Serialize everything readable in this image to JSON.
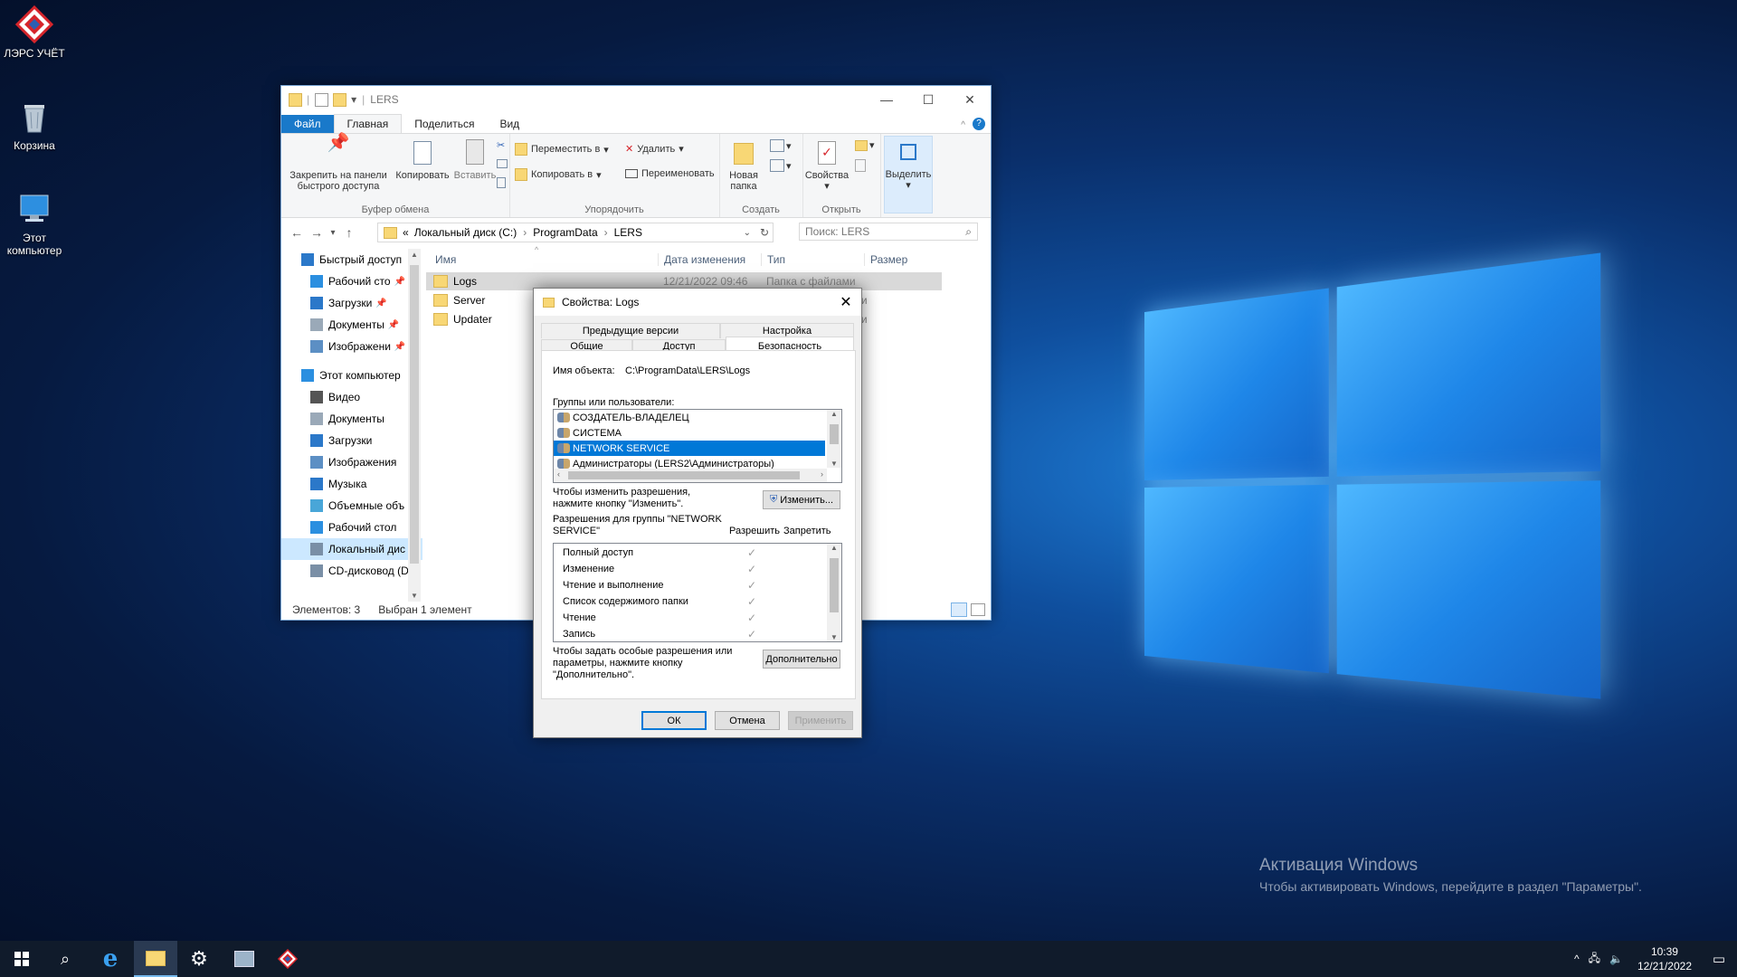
{
  "desktop": {
    "icons": [
      {
        "label": "ЛЭРС УЧЁТ"
      },
      {
        "label": "Корзина"
      },
      {
        "label": "Этот компьютер"
      }
    ],
    "watermark": {
      "title": "Активация Windows",
      "text": "Чтобы активировать Windows, перейдите в раздел \"Параметры\"."
    }
  },
  "explorer": {
    "title": "LERS",
    "tabs": {
      "file": "Файл",
      "home": "Главная",
      "share": "Поделиться",
      "view": "Вид"
    },
    "ribbon": {
      "pin": "Закрепить на панели быстрого доступа",
      "copy": "Копировать",
      "paste": "Вставить",
      "clipboard_group": "Буфер обмена",
      "move_to": "Переместить в",
      "copy_to": "Копировать в",
      "delete": "Удалить",
      "rename": "Переименовать",
      "organize_group": "Упорядочить",
      "new_folder": "Новая папка",
      "create_group": "Создать",
      "properties": "Свойства",
      "open_group": "Открыть",
      "select": "Выделить"
    },
    "address": {
      "prefix": "«",
      "crumbs": [
        "Локальный диск (C:)",
        "ProgramData",
        "LERS"
      ]
    },
    "search_placeholder": "Поиск: LERS",
    "nav": [
      {
        "label": "Быстрый доступ",
        "icon": "star-icon",
        "indent": 0
      },
      {
        "label": "Рабочий сто",
        "icon": "desktop-icon",
        "indent": 1,
        "pin": true
      },
      {
        "label": "Загрузки",
        "icon": "download-icon",
        "indent": 1,
        "pin": true
      },
      {
        "label": "Документы",
        "icon": "document-icon",
        "indent": 1,
        "pin": true
      },
      {
        "label": "Изображени",
        "icon": "image-icon",
        "indent": 1,
        "pin": true
      },
      {
        "label": "Этот компьютер",
        "icon": "computer-icon",
        "indent": 0,
        "gap": true
      },
      {
        "label": "Видео",
        "icon": "video-icon",
        "indent": 1
      },
      {
        "label": "Документы",
        "icon": "document-icon",
        "indent": 1
      },
      {
        "label": "Загрузки",
        "icon": "download-icon",
        "indent": 1
      },
      {
        "label": "Изображения",
        "icon": "image-icon",
        "indent": 1
      },
      {
        "label": "Музыка",
        "icon": "music-icon",
        "indent": 1
      },
      {
        "label": "Объемные объ",
        "icon": "cube-icon",
        "indent": 1
      },
      {
        "label": "Рабочий стол",
        "icon": "desktop-icon",
        "indent": 1
      },
      {
        "label": "Локальный дис",
        "icon": "drive-icon",
        "indent": 1,
        "selected": true
      },
      {
        "label": "CD-дисковод (D",
        "icon": "cd-icon",
        "indent": 1
      }
    ],
    "columns": {
      "name": "Имя",
      "date": "Дата изменения",
      "type": "Тип",
      "size": "Размер"
    },
    "files": [
      {
        "name": "Logs",
        "date": "12/21/2022 09:46",
        "type": "Папка с файлами",
        "selected": true
      },
      {
        "name": "Server",
        "date": "",
        "type": "ами"
      },
      {
        "name": "Updater",
        "date": "",
        "type": "ами"
      }
    ],
    "status": {
      "count": "Элементов: 3",
      "selected": "Выбран 1 элемент"
    }
  },
  "dialog": {
    "title": "Свойства: Logs",
    "tabs_row1": [
      "Предыдущие версии",
      "Настройка"
    ],
    "tabs_row2": [
      "Общие",
      "Доступ",
      "Безопасность"
    ],
    "object_label": "Имя объекта:",
    "object_value": "C:\\ProgramData\\LERS\\Logs",
    "groups_label": "Группы или пользователи:",
    "groups": [
      {
        "name": "СОЗДАТЕЛЬ-ВЛАДЕЛЕЦ"
      },
      {
        "name": "СИСТЕМА"
      },
      {
        "name": "NETWORK SERVICE",
        "selected": true
      },
      {
        "name": "Администраторы (LERS2\\Администраторы)"
      }
    ],
    "change_text": "Чтобы изменить разрешения, нажмите кнопку \"Изменить\".",
    "change_button": "Изменить...",
    "perms_label": "Разрешения для группы \"NETWORK SERVICE\"",
    "allow": "Разрешить",
    "deny": "Запретить",
    "permissions": [
      {
        "name": "Полный доступ",
        "allow": true
      },
      {
        "name": "Изменение",
        "allow": true
      },
      {
        "name": "Чтение и выполнение",
        "allow": true
      },
      {
        "name": "Список содержимого папки",
        "allow": true
      },
      {
        "name": "Чтение",
        "allow": true
      },
      {
        "name": "Запись",
        "allow": true
      }
    ],
    "advanced_text": "Чтобы задать особые разрешения или параметры, нажмите кнопку \"Дополнительно\".",
    "advanced_button": "Дополнительно",
    "ok": "ОК",
    "cancel": "Отмена",
    "apply": "Применить"
  },
  "taskbar": {
    "time": "10:39",
    "date": "12/21/2022"
  }
}
